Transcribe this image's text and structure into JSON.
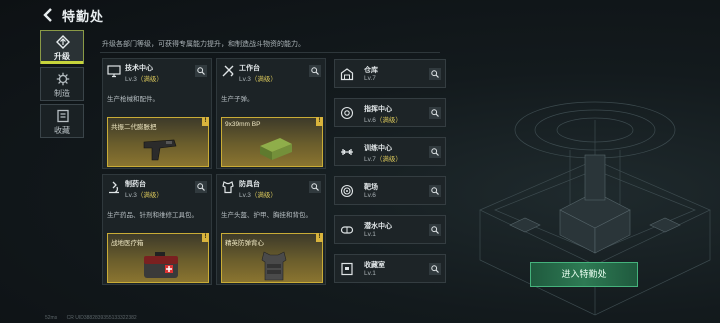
{
  "header": {
    "title": "特勤处"
  },
  "tabs": [
    {
      "label": "升级",
      "active": true,
      "icon": "arrow-up-icon"
    },
    {
      "label": "制造",
      "active": false,
      "icon": "gear-icon"
    },
    {
      "label": "收藏",
      "active": false,
      "icon": "collection-icon"
    }
  ],
  "description": "升级各部门等级，可获得专属能力提升，和制造战斗物资的能力。",
  "cards": [
    {
      "name": "技术中心",
      "level": "Lv.3",
      "max_label": "（满级）",
      "desc": "生产枪械和配件。",
      "item": "共振二代膨胀把",
      "badge": "!",
      "icon": "monitor-icon"
    },
    {
      "name": "工作台",
      "level": "Lv.3",
      "max_label": "（满级）",
      "desc": "生产子弹。",
      "item": "9x39mm BP",
      "badge": "!",
      "icon": "tools-icon"
    },
    {
      "name": "制药台",
      "level": "Lv.3",
      "max_label": "（满级）",
      "desc": "生产药品、针剂和维修工具包。",
      "item": "战地医疗箱",
      "badge": "!",
      "icon": "microscope-icon"
    },
    {
      "name": "防具台",
      "level": "Lv.3",
      "max_label": "（满级）",
      "desc": "生产头盔、护甲、胸挂和背包。",
      "item": "精英防弹背心",
      "badge": "!",
      "icon": "armor-icon"
    }
  ],
  "facilities": [
    {
      "name": "仓库",
      "level": "Lv.7",
      "max_label": "",
      "icon": "warehouse-icon"
    },
    {
      "name": "指挥中心",
      "level": "Lv.6",
      "max_label": "（满级）",
      "icon": "command-icon"
    },
    {
      "name": "训练中心",
      "level": "Lv.7",
      "max_label": "（满级）",
      "icon": "dumbbell-icon"
    },
    {
      "name": "靶场",
      "level": "Lv.6",
      "max_label": "",
      "icon": "target-icon"
    },
    {
      "name": "潜水中心",
      "level": "Lv.1",
      "max_label": "",
      "icon": "diving-icon"
    },
    {
      "name": "收藏室",
      "level": "Lv.1",
      "max_label": "",
      "icon": "trophy-icon"
    }
  ],
  "enter_button": "进入特勤处",
  "footer": {
    "latency": "52ms",
    "uid": "CR UID3882839355133322382"
  },
  "colors": {
    "accent": "#c7d43b",
    "gold": "#c9ac36",
    "green": "#45b27c"
  }
}
